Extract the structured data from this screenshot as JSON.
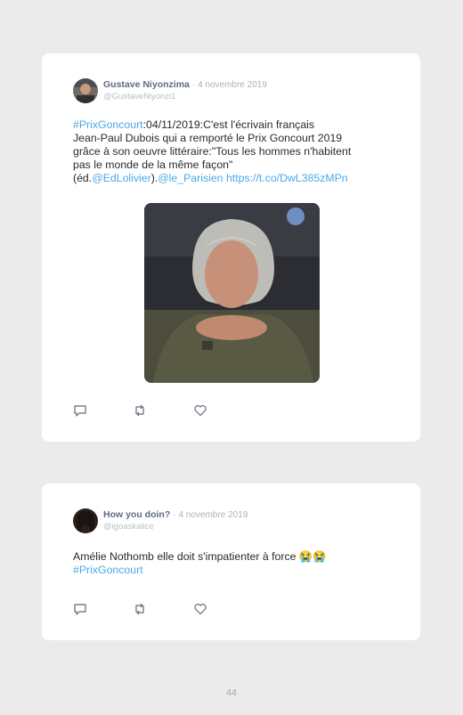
{
  "tweets": [
    {
      "author": "Gustave Niyonzima",
      "separator": "·",
      "date": "4 novembre 2019",
      "handle": "@GustaveNiyonzi1",
      "segments": [
        {
          "text": "#PrixGoncourt",
          "link": true
        },
        {
          "text": ":04/11/2019:C'est l'écrivain français",
          "link": false
        },
        {
          "text": "Jean-Paul Dubois qui a remporté le Prix Goncourt 2019",
          "link": false
        },
        {
          "text": "grâce à son oeuvre littéraire:\"Tous les hommes n'habitent",
          "link": false
        },
        {
          "text": "pas le monde de la même façon\"",
          "link": false
        },
        {
          "text": "(éd.",
          "link": false
        },
        {
          "text": "@EdLolivier",
          "link": true
        },
        {
          "text": ").",
          "link": false
        },
        {
          "text": "@le_Parisien",
          "link": true
        },
        {
          "text": " ",
          "link": false
        },
        {
          "text": "https://t.co/DwL385zMPn",
          "link": true
        }
      ],
      "actions": {
        "reply_icon": "reply-icon",
        "retweet_icon": "retweet-icon",
        "like_icon": "heart-icon"
      }
    },
    {
      "author": "How you doin?",
      "separator": "·",
      "date": "4 novembre 2019",
      "handle": "@igoaskalice",
      "segments": [
        {
          "text": "Amélie Nothomb elle doit s'impatienter à force 😭😭",
          "link": false
        },
        {
          "text": "#PrixGoncourt",
          "link": true
        }
      ],
      "actions": {
        "reply_icon": "reply-icon",
        "retweet_icon": "retweet-icon",
        "like_icon": "heart-icon"
      }
    }
  ],
  "page_number": "44",
  "colors": {
    "background": "#ebebeb",
    "card": "#ffffff",
    "link": "#4aa8e8",
    "author": "#5e6c82",
    "muted": "#a9b3bd",
    "icon": "#5f6b7a"
  }
}
